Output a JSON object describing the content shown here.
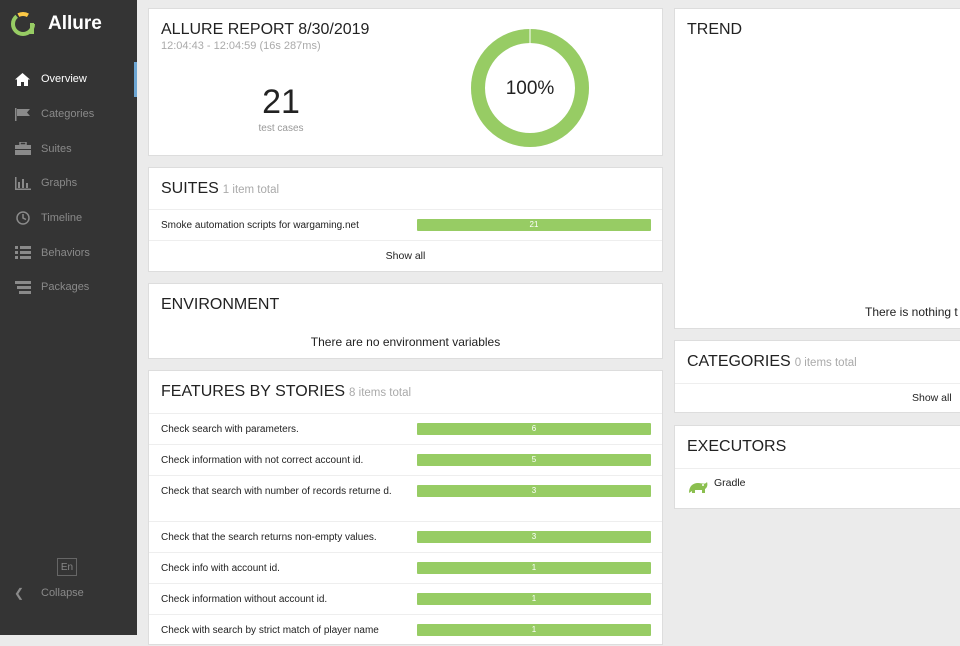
{
  "app": {
    "name": "Allure"
  },
  "sidebar": {
    "items": [
      {
        "label": "Overview",
        "icon": "home-icon"
      },
      {
        "label": "Categories",
        "icon": "flag-icon"
      },
      {
        "label": "Suites",
        "icon": "briefcase-icon"
      },
      {
        "label": "Graphs",
        "icon": "bar-chart-icon"
      },
      {
        "label": "Timeline",
        "icon": "clock-icon"
      },
      {
        "label": "Behaviors",
        "icon": "list-icon"
      },
      {
        "label": "Packages",
        "icon": "packages-icon"
      }
    ],
    "active": "Overview",
    "language": "En",
    "collapse_label": "Collapse"
  },
  "summary": {
    "title": "ALLURE REPORT 8/30/2019",
    "time": "12:04:43 - 12:04:59 (16s 287ms)",
    "test_count": "21",
    "test_label": "test cases",
    "percent": "100%",
    "pass_fraction": 1.0
  },
  "suites": {
    "title": "SUITES",
    "subtitle": "1 item total",
    "rows": [
      {
        "label": "Smoke automation scripts for wargaming.net",
        "value": "21"
      }
    ],
    "show_all": "Show all"
  },
  "environment": {
    "title": "ENVIRONMENT",
    "message": "There are no environment variables"
  },
  "features": {
    "title": "FEATURES BY STORIES",
    "subtitle": "8 items total",
    "rows": [
      {
        "label": "Check search with parameters.",
        "value": "6"
      },
      {
        "label": "Check information with not correct account id.",
        "value": "5"
      },
      {
        "label": "Check that search with number of records returne d.",
        "value": "3"
      },
      {
        "label": "Check that the search returns non-empty values.",
        "value": "3"
      },
      {
        "label": "Check info with account id.",
        "value": "1"
      },
      {
        "label": "Check information without account id.",
        "value": "1"
      },
      {
        "label": "Check with search by strict match of player name",
        "value": "1"
      }
    ]
  },
  "trend": {
    "title": "TREND",
    "message": "There is nothing t"
  },
  "categories": {
    "title": "CATEGORIES",
    "subtitle": "0 items total",
    "show_all": "Show all"
  },
  "executors": {
    "title": "EXECUTORS",
    "items": [
      {
        "label": "Gradle",
        "icon": "gradle-icon"
      }
    ]
  },
  "colors": {
    "passed": "#97cc64",
    "sidebar": "#343434",
    "accent": "#6da6d3"
  }
}
